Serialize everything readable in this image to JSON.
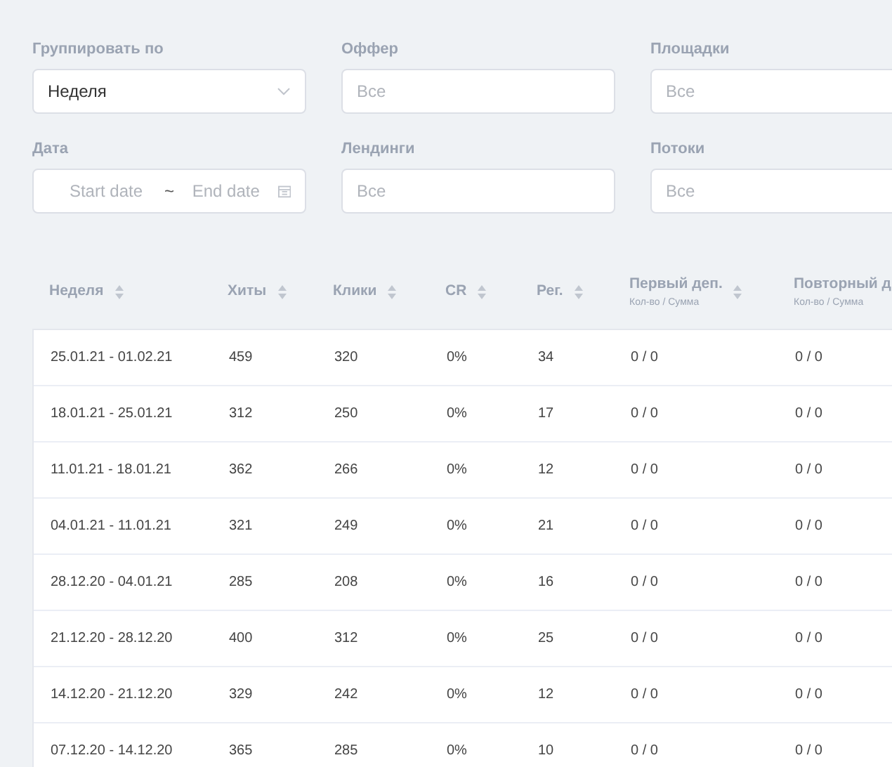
{
  "filters": [
    {
      "label": "Группировать по",
      "kind": "select",
      "value": "Неделя"
    },
    {
      "label": "Оффер",
      "kind": "input",
      "placeholder": "Все"
    },
    {
      "label": "Площадки",
      "kind": "input",
      "placeholder": "Все"
    },
    {
      "label": "Дата",
      "kind": "daterange",
      "start_placeholder": "Start date",
      "separator": "~",
      "end_placeholder": "End date"
    },
    {
      "label": "Лендинги",
      "kind": "input",
      "placeholder": "Все"
    },
    {
      "label": "Потоки",
      "kind": "input",
      "placeholder": "Все"
    }
  ],
  "table": {
    "columns": [
      {
        "label": "Неделя",
        "sortable": true
      },
      {
        "label": "Хиты",
        "sortable": true
      },
      {
        "label": "Клики",
        "sortable": true
      },
      {
        "label": "CR",
        "sortable": true
      },
      {
        "label": "Рег.",
        "sortable": true
      },
      {
        "label": "Первый деп.",
        "sub": "Кол-во / Сумма",
        "sortable": true
      },
      {
        "label": "Повторный д",
        "sub": "Кол-во / Сумма"
      }
    ],
    "rows": [
      [
        "25.01.21 - 01.02.21",
        "459",
        "320",
        "0%",
        "34",
        "0 / 0",
        "0 / 0"
      ],
      [
        "18.01.21 - 25.01.21",
        "312",
        "250",
        "0%",
        "17",
        "0 / 0",
        "0 / 0"
      ],
      [
        "11.01.21 - 18.01.21",
        "362",
        "266",
        "0%",
        "12",
        "0 / 0",
        "0 / 0"
      ],
      [
        "04.01.21 - 11.01.21",
        "321",
        "249",
        "0%",
        "21",
        "0 / 0",
        "0 / 0"
      ],
      [
        "28.12.20 - 04.01.21",
        "285",
        "208",
        "0%",
        "16",
        "0 / 0",
        "0 / 0"
      ],
      [
        "21.12.20 - 28.12.20",
        "400",
        "312",
        "0%",
        "25",
        "0 / 0",
        "0 / 0"
      ],
      [
        "14.12.20 - 21.12.20",
        "329",
        "242",
        "0%",
        "12",
        "0 / 0",
        "0 / 0"
      ],
      [
        "07.12.20 - 14.12.20",
        "365",
        "285",
        "0%",
        "10",
        "0 / 0",
        "0 / 0"
      ]
    ]
  }
}
